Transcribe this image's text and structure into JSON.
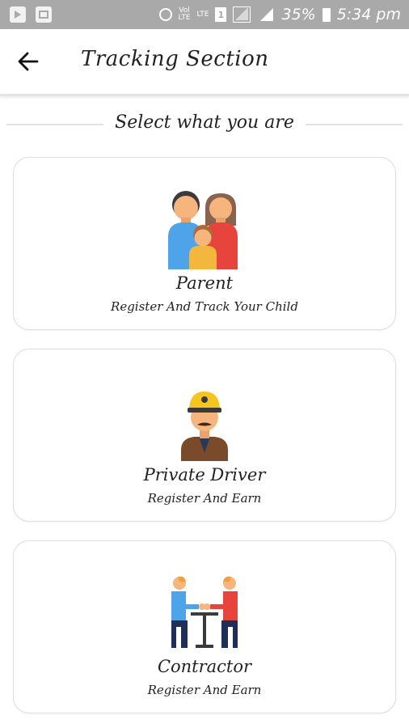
{
  "status_bar": {
    "volte_label": "Vol\nLTE",
    "lte_label": "LTE",
    "sim_label": "1",
    "battery_percent": "35%",
    "time": "5:34 pm"
  },
  "app_bar": {
    "title": "Tracking Section",
    "back_icon": "arrow-left-icon"
  },
  "section": {
    "heading": "Select what you are"
  },
  "options": [
    {
      "icon": "family-icon",
      "name": "Parent",
      "subtitle": "Register And Track Your Child"
    },
    {
      "icon": "driver-icon",
      "name": "Private Driver",
      "subtitle": "Register And Earn"
    },
    {
      "icon": "meeting-icon",
      "name": "Contractor",
      "subtitle": "Register And Earn"
    }
  ],
  "colors": {
    "status_bar": "#a9a9a9",
    "card_border": "#dedede",
    "divider": "#e2e2e2"
  }
}
